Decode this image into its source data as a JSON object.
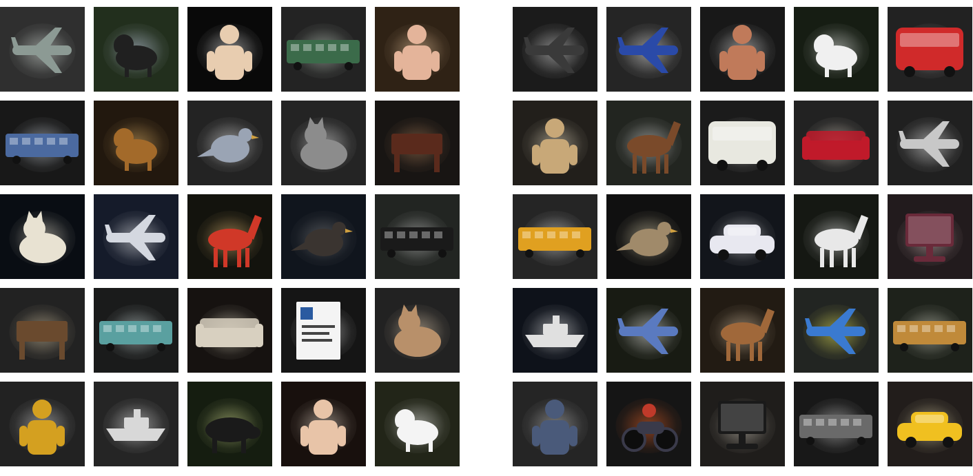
{
  "panels": [
    {
      "id": "left",
      "tiles": [
        {
          "subject": "airplane",
          "bg": "#3a3a3a",
          "fg": "#8c9a94",
          "glow": "#e8f0ea",
          "shape": "plane"
        },
        {
          "subject": "dog-on-skateboard",
          "bg": "#2a3a24",
          "fg": "#202020",
          "glow": "#d8e0ff",
          "shape": "dog"
        },
        {
          "subject": "baby",
          "bg": "#0c0c0c",
          "fg": "#e8cdb0",
          "glow": "#ffffff",
          "shape": "person"
        },
        {
          "subject": "train",
          "bg": "#2b2b2b",
          "fg": "#3b6b4a",
          "glow": "#dfeee0",
          "shape": "train"
        },
        {
          "subject": "boy-at-desk",
          "bg": "#3a2a1a",
          "fg": "#e4b49a",
          "glow": "#ffd9b0",
          "shape": "person"
        },
        {
          "subject": "locomotive",
          "bg": "#1e1e1e",
          "fg": "#4b6aa0",
          "glow": "#e6eef8",
          "shape": "train"
        },
        {
          "subject": "beagle",
          "bg": "#2a1e12",
          "fg": "#a36a2a",
          "glow": "#f0c070",
          "shape": "dog"
        },
        {
          "subject": "pigeon",
          "bg": "#2b2b2b",
          "fg": "#9aa4b4",
          "glow": "#ffffff",
          "shape": "bird"
        },
        {
          "subject": "cat",
          "bg": "#2d2d2d",
          "fg": "#8c8c8c",
          "glow": "#f4f4f4",
          "shape": "cat"
        },
        {
          "subject": "ottoman",
          "bg": "#1e1a18",
          "fg": "#5a2a1c",
          "glow": "#c08a60",
          "shape": "table"
        },
        {
          "subject": "polar-bear",
          "bg": "#0c1018",
          "fg": "#e8e2d2",
          "glow": "#fff6e0",
          "shape": "cat"
        },
        {
          "subject": "jet-front",
          "bg": "#1a2234",
          "fg": "#d4d8e0",
          "glow": "#ffffff",
          "shape": "plane"
        },
        {
          "subject": "girl-on-pony",
          "bg": "#181810",
          "fg": "#d03828",
          "glow": "#ffd080",
          "shape": "horse"
        },
        {
          "subject": "swan",
          "bg": "#141a24",
          "fg": "#3a3430",
          "glow": "#8a8a8a",
          "shape": "bird"
        },
        {
          "subject": "steam-train",
          "bg": "#2a2e2a",
          "fg": "#1a1a1a",
          "glow": "#e0e0e0",
          "shape": "train"
        },
        {
          "subject": "chair",
          "bg": "#2a2a2a",
          "fg": "#6a4a2e",
          "glow": "#f4e0b8",
          "shape": "table"
        },
        {
          "subject": "electric-train",
          "bg": "#202222",
          "fg": "#5aa0a0",
          "glow": "#e8f8f8",
          "shape": "train"
        },
        {
          "subject": "sofa",
          "bg": "#1c1614",
          "fg": "#d8d0c0",
          "glow": "#fff8e0",
          "shape": "sofa"
        },
        {
          "subject": "sign",
          "bg": "#1a1a1a",
          "fg": "#f4f4f4",
          "glow": "#ffffff",
          "shape": "sign"
        },
        {
          "subject": "sleeping-cat",
          "bg": "#2a2a2a",
          "fg": "#b8906a",
          "glow": "#f8e0c0",
          "shape": "cat"
        },
        {
          "subject": "people-on-train",
          "bg": "#2a2a2a",
          "fg": "#d4a020",
          "glow": "#e8e8e8",
          "shape": "person"
        },
        {
          "subject": "boat-in-dark",
          "bg": "#2e2e2e",
          "fg": "#d8d8d8",
          "glow": "#ffffff",
          "shape": "boat"
        },
        {
          "subject": "bull",
          "bg": "#1a2414",
          "fg": "#1a1a1a",
          "glow": "#e8f0a0",
          "shape": "cow"
        },
        {
          "subject": "woman-drinking",
          "bg": "#1e1410",
          "fg": "#e8c4a8",
          "glow": "#fff0e0",
          "shape": "person"
        },
        {
          "subject": "white-dog",
          "bg": "#2a2e1e",
          "fg": "#f4f4f4",
          "glow": "#ffffff",
          "shape": "dog"
        }
      ]
    },
    {
      "id": "right",
      "tiles": [
        {
          "subject": "small-airplane",
          "bg": "#222222",
          "fg": "#3a3a3a",
          "glow": "#f0f0f0",
          "shape": "plane"
        },
        {
          "subject": "airliner",
          "bg": "#2e2e2e",
          "fg": "#2a4aa8",
          "glow": "#ffffff",
          "shape": "plane"
        },
        {
          "subject": "people-jumping",
          "bg": "#1e1e1e",
          "fg": "#c07a5a",
          "glow": "#ffffff",
          "shape": "person"
        },
        {
          "subject": "white-dog-field",
          "bg": "#1c2418",
          "fg": "#f0f0f0",
          "glow": "#ffffff",
          "shape": "dog"
        },
        {
          "subject": "red-bus",
          "bg": "#2a2a2a",
          "fg": "#d02a2a",
          "glow": "#f8e8e8",
          "shape": "bus"
        },
        {
          "subject": "woman-reading",
          "bg": "#2a2622",
          "fg": "#c8a878",
          "glow": "#fff4d8",
          "shape": "person"
        },
        {
          "subject": "horse",
          "bg": "#2a2e28",
          "fg": "#7a4a2a",
          "glow": "#f0f0f0",
          "shape": "horse"
        },
        {
          "subject": "city-bus",
          "bg": "#222222",
          "fg": "#e8e8e0",
          "glow": "#ffffff",
          "shape": "bus"
        },
        {
          "subject": "red-sofa",
          "bg": "#2a2a2a",
          "fg": "#c01a2a",
          "glow": "#fff0e0",
          "shape": "sofa"
        },
        {
          "subject": "prop-plane",
          "bg": "#282828",
          "fg": "#c8c8c8",
          "glow": "#ffffff",
          "shape": "plane"
        },
        {
          "subject": "yellow-train",
          "bg": "#2e2e2e",
          "fg": "#e0a020",
          "glow": "#ffffff",
          "shape": "train"
        },
        {
          "subject": "falcon",
          "bg": "#141414",
          "fg": "#a08a6a",
          "glow": "#f4e8c0",
          "shape": "bird"
        },
        {
          "subject": "rally-car",
          "bg": "#161a22",
          "fg": "#e8e8f0",
          "glow": "#ffffff",
          "shape": "car"
        },
        {
          "subject": "white-horse",
          "bg": "#1a1e18",
          "fg": "#e8e8e8",
          "glow": "#ffffff",
          "shape": "horse"
        },
        {
          "subject": "tv-room",
          "bg": "#2a2224",
          "fg": "#6a2a3a",
          "glow": "#f0d0d0",
          "shape": "tv"
        },
        {
          "subject": "ship-at-night",
          "bg": "#121620",
          "fg": "#e0e0e0",
          "glow": "#ffffff",
          "shape": "boat"
        },
        {
          "subject": "fighter-jet",
          "bg": "#1e2218",
          "fg": "#5a7ac0",
          "glow": "#ffffff",
          "shape": "plane"
        },
        {
          "subject": "horse-stable",
          "bg": "#2a2218",
          "fg": "#a0683a",
          "glow": "#f0d8b8",
          "shape": "horse"
        },
        {
          "subject": "ukraine-airliner",
          "bg": "#2a2e2a",
          "fg": "#3a7ad0",
          "glow": "#ffff60",
          "shape": "plane"
        },
        {
          "subject": "freight-train",
          "bg": "#252a22",
          "fg": "#c08a3a",
          "glow": "#f0f0e0",
          "shape": "train"
        },
        {
          "subject": "child-walking",
          "bg": "#2e2e2e",
          "fg": "#4a5a7a",
          "glow": "#cfcfcf",
          "shape": "person"
        },
        {
          "subject": "motorcycle",
          "bg": "#1a1a1a",
          "fg": "#3a3a4a",
          "glow": "#ff6a2a",
          "shape": "moto"
        },
        {
          "subject": "living-room",
          "bg": "#262422",
          "fg": "#1a1a1a",
          "glow": "#f0e8d8",
          "shape": "tv"
        },
        {
          "subject": "steam-locomotive",
          "bg": "#1e1e1e",
          "fg": "#6a6a6a",
          "glow": "#e8e8e8",
          "shape": "train"
        },
        {
          "subject": "taxi",
          "bg": "#2a2422",
          "fg": "#f0c020",
          "glow": "#fff4c0",
          "shape": "car"
        }
      ]
    }
  ]
}
